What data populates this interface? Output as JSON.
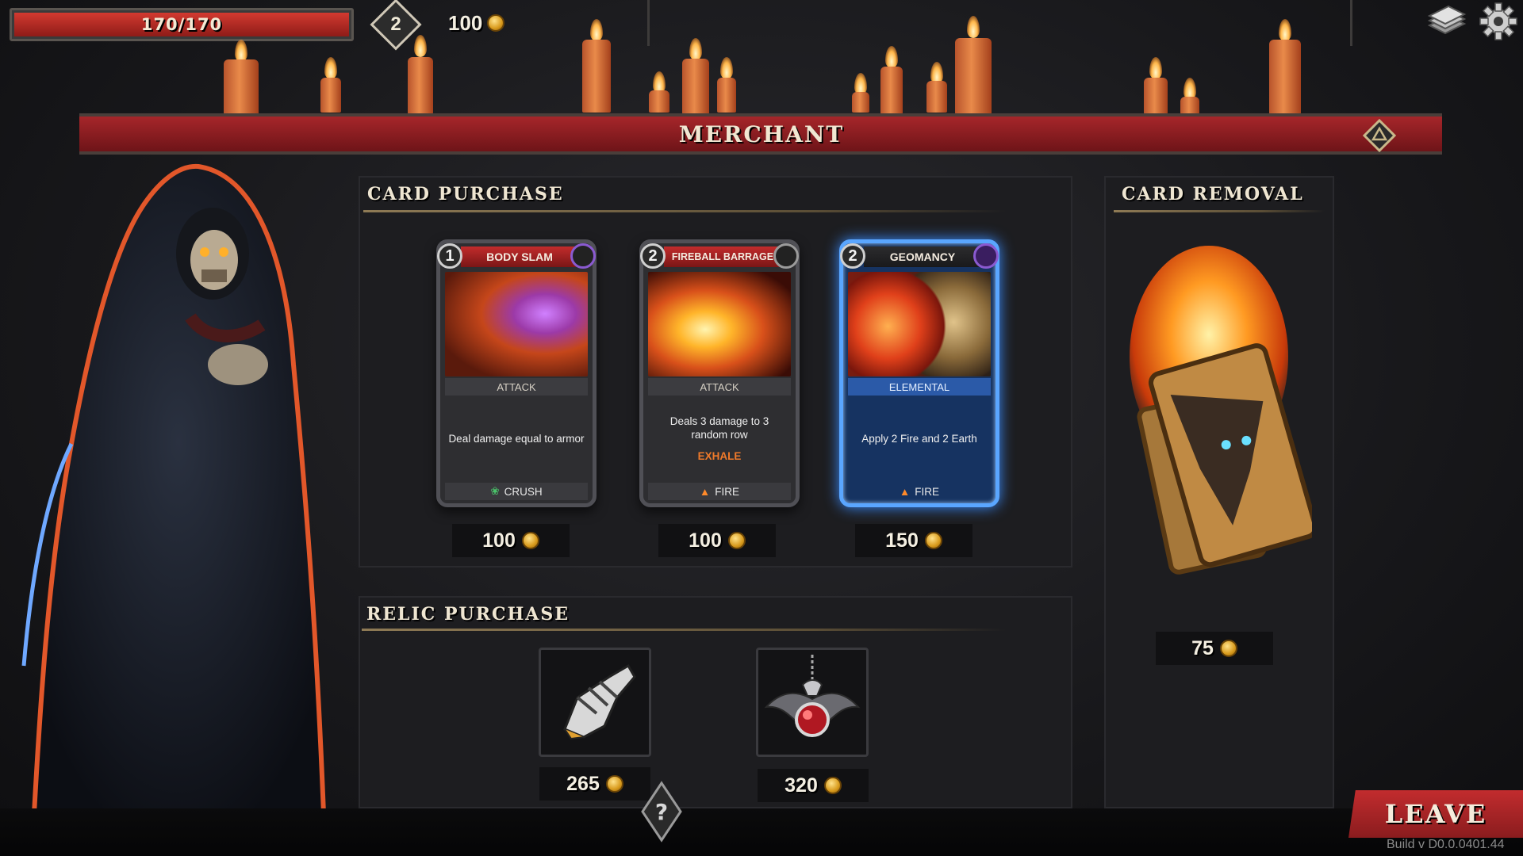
{
  "hud": {
    "hp": "170/170",
    "level": "2",
    "gold": "100"
  },
  "banner": {
    "title": "MERCHANT"
  },
  "card_purchase": {
    "title": "CARD PURCHASE",
    "cards": [
      {
        "cost": "1",
        "name": "BODY SLAM",
        "type": "ATTACK",
        "desc": "Deal damage equal to armor",
        "keyword": "",
        "tag": "CRUSH",
        "price": "100"
      },
      {
        "cost": "2",
        "name": "FIREBALL BARRAGE",
        "type": "ATTACK",
        "desc": "Deals 3 damage to 3 random row",
        "keyword": "EXHALE",
        "tag": "FIRE",
        "price": "100"
      },
      {
        "cost": "2",
        "name": "GEOMANCY",
        "type": "ELEMENTAL",
        "desc": "Apply 2 Fire and 2 Earth",
        "keyword": "",
        "tag": "FIRE",
        "price": "150"
      }
    ]
  },
  "relic_purchase": {
    "title": "RELIC PURCHASE",
    "relics": [
      {
        "icon": "gauntlet-relic-icon",
        "price": "265"
      },
      {
        "icon": "dragon-amulet-relic-icon",
        "price": "320"
      }
    ]
  },
  "card_removal": {
    "title": "CARD REMOVAL",
    "price": "75"
  },
  "leave_label": "LEAVE",
  "build": "Build v D0.0.0401.44",
  "colors": {
    "banner_red": "#a6262a",
    "hp_red": "#d23a30",
    "elemental_blue": "#5aa6ff",
    "gold": "#d89a1c"
  }
}
